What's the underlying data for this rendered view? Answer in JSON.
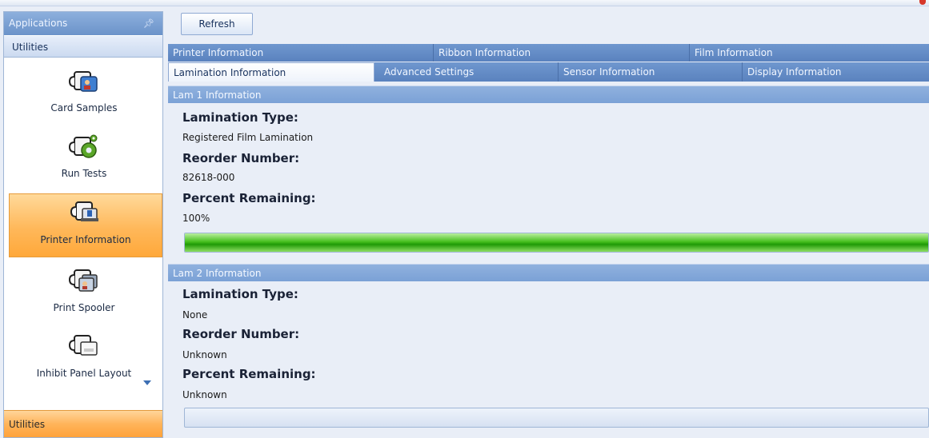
{
  "sidebar": {
    "header": "Applications",
    "group_top": "Utilities",
    "group_bottom": "Utilities",
    "items": [
      {
        "label": "Card Samples",
        "icon": "card-samples-icon"
      },
      {
        "label": "Run Tests",
        "icon": "run-tests-gear-icon"
      },
      {
        "label": "Printer Information",
        "icon": "printer-information-icon",
        "active": true
      },
      {
        "label": "Print Spooler",
        "icon": "print-spooler-icon"
      },
      {
        "label": "Inhibit Panel Layout",
        "icon": "inhibit-panel-layout-icon"
      }
    ]
  },
  "toolbar": {
    "refresh_label": "Refresh"
  },
  "tabs": {
    "row1": [
      "Printer Information",
      "Ribbon Information",
      "Film Information"
    ],
    "row2": [
      "Lamination Information",
      "Advanced Settings",
      "Sensor Information",
      "Display Information"
    ],
    "selected": "Lamination Information"
  },
  "lam1": {
    "header": "Lam 1 Information",
    "type_label": "Lamination Type:",
    "type_value": "Registered Film Lamination",
    "reorder_label": "Reorder Number:",
    "reorder_value": "82618-000",
    "percent_label": "Percent Remaining:",
    "percent_value": "100%",
    "progress": 1.0
  },
  "lam2": {
    "header": "Lam 2 Information",
    "type_label": "Lamination Type:",
    "type_value": "None",
    "reorder_label": "Reorder Number:",
    "reorder_value": "Unknown",
    "percent_label": "Percent Remaining:",
    "percent_value": "Unknown",
    "progress": 0
  },
  "colors": {
    "progress_green": "#2fb010",
    "active_item": "#ffb85a",
    "tab_bar": "#5a82be"
  }
}
